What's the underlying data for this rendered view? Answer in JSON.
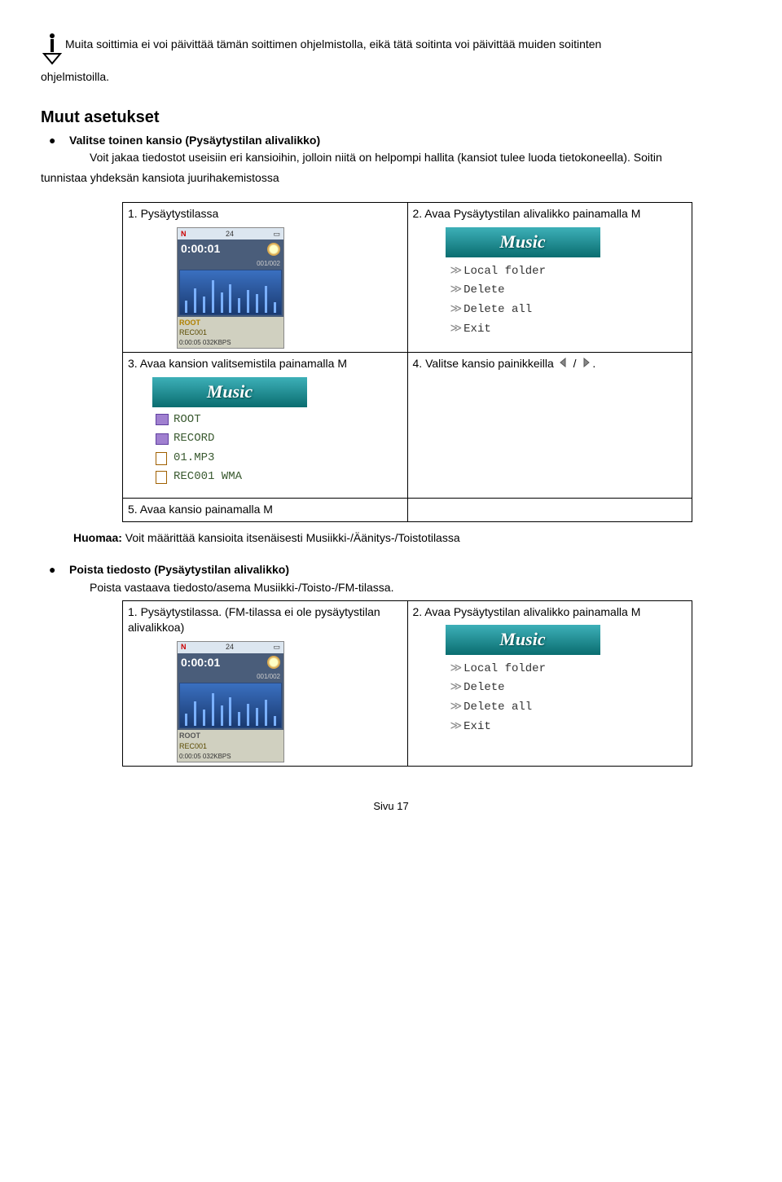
{
  "warning": {
    "line1": "Muita soittimia ei voi päivittää tämän soittimen ohjelmistolla, eikä tätä soitinta voi päivittää muiden soitinten",
    "line2": "ohjelmistoilla."
  },
  "section1": {
    "title": "Muut asetukset",
    "bullet_heading": "Valitse toinen kansio (Pysäytystilan alivalikko)",
    "para_indent": "Voit jakaa tiedostot useisiin eri kansioihin, jolloin niitä on helpompi hallita (kansiot tulee luoda tietokoneella). Soitin",
    "para_noindent": "tunnistaa yhdeksän kansiota juurihakemistossa"
  },
  "table1": {
    "r1c1": "1. Pysäytystilassa",
    "r1c2": "2. Avaa Pysäytystilan alivalikko painamalla M",
    "r2c1": "3. Avaa kansion valitsemistila painamalla M",
    "r2c2_a": "4. Valitse kansio painikkeilla",
    "r2c2_b": " / ",
    "r2c2_c": ".",
    "r3c1": "5. Avaa kansio painamalla M"
  },
  "player": {
    "top_left": "N",
    "top_mid": "24",
    "time": "0:00:01",
    "counter": "001/002",
    "root": "ROOT",
    "rec": "REC001",
    "bitrate": "0:00:05 032KBPS"
  },
  "music_menu": {
    "header": "Music",
    "items": [
      "Local folder",
      "Delete",
      "Delete all",
      "Exit"
    ]
  },
  "folder_menu": {
    "header": "Music",
    "items": [
      {
        "type": "folder",
        "label": "ROOT"
      },
      {
        "type": "folder",
        "label": "RECORD"
      },
      {
        "type": "file",
        "label": "01.MP3"
      },
      {
        "type": "file",
        "label": "REC001  WMA"
      }
    ]
  },
  "note": {
    "label": "Huomaa:",
    "text": " Voit määrittää kansioita itsenäisesti Musiikki-/Äänitys-/Toistotilassa"
  },
  "section2": {
    "bullet_heading": "Poista tiedosto (Pysäytystilan alivalikko)",
    "para": "Poista vastaava tiedosto/asema Musiikki-/Toisto-/FM-tilassa."
  },
  "table2": {
    "r1c1": "1. Pysäytystilassa. (FM-tilassa ei ole pysäytystilan alivalikkoa)",
    "r1c2": "2. Avaa Pysäytystilan alivalikko painamalla M"
  },
  "footer": "Sivu 17"
}
